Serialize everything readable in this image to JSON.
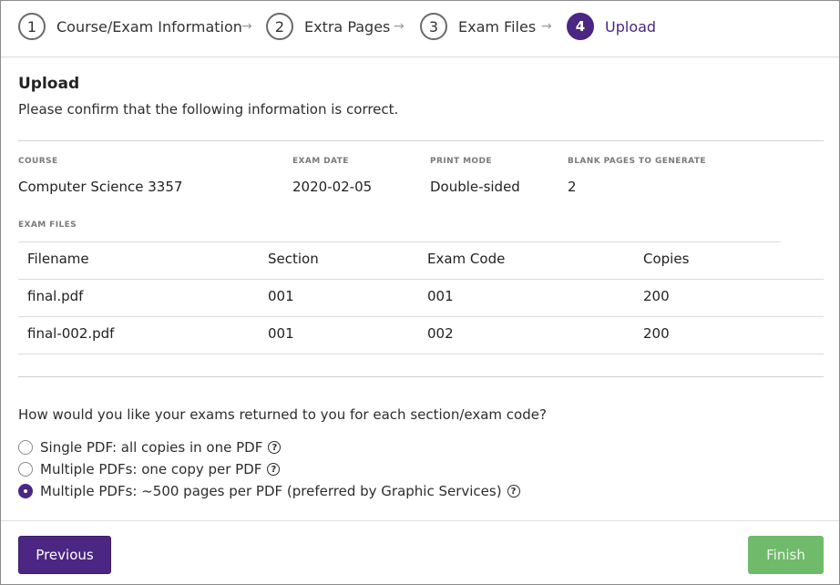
{
  "stepper": {
    "steps": [
      {
        "number": "1",
        "label": "Course/Exam Information"
      },
      {
        "number": "2",
        "label": "Extra Pages"
      },
      {
        "number": "3",
        "label": "Exam Files"
      },
      {
        "number": "4",
        "label": "Upload"
      }
    ],
    "arrow": "→",
    "active_step": 4
  },
  "main": {
    "title": "Upload",
    "subtitle": "Please confirm that the following information is correct."
  },
  "summary": {
    "course_label": "COURSE",
    "course_value": "Computer Science 3357",
    "exam_date_label": "EXAM DATE",
    "exam_date_value": "2020-02-05",
    "print_mode_label": "PRINT MODE",
    "print_mode_value": "Double-sided",
    "blank_pages_label": "BLANK PAGES TO GENERATE",
    "blank_pages_value": "2"
  },
  "files": {
    "label": "EXAM FILES",
    "columns": [
      "Filename",
      "Section",
      "Exam Code",
      "Copies"
    ],
    "rows": [
      [
        "final.pdf",
        "001",
        "001",
        "200"
      ],
      [
        "final-002.pdf",
        "001",
        "002",
        "200"
      ]
    ]
  },
  "return_options": {
    "question": "How would you like your exams returned to you for each section/exam code?",
    "options": [
      {
        "label": "Single PDF: all copies in one PDF",
        "checked": false
      },
      {
        "label": "Multiple PDFs: one copy per PDF",
        "checked": false
      },
      {
        "label": "Multiple PDFs: ~500 pages per PDF (preferred by Graphic Services)",
        "checked": true
      }
    ],
    "help_glyph": "?"
  },
  "footer": {
    "previous_label": "Previous",
    "finish_label": "Finish"
  },
  "colors": {
    "accent": "#4b2683",
    "finish": "#6fba6b",
    "divider": "#dcdcdc"
  }
}
